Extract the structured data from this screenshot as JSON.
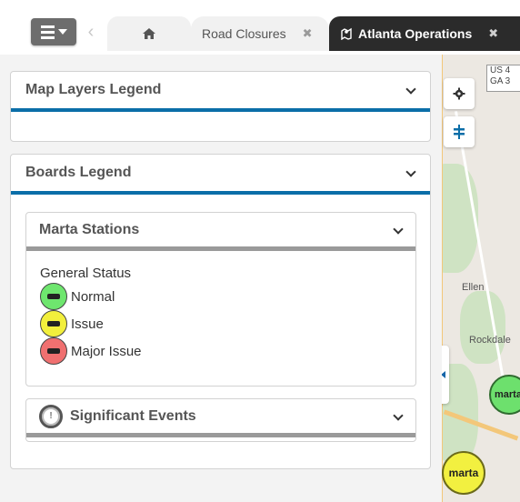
{
  "tabs": {
    "road_closures": "Road Closures",
    "atlanta_operations": "Atlanta Operations"
  },
  "panel": {
    "map_layers_title": "Map Layers Legend",
    "boards_title": "Boards Legend",
    "marta": {
      "title": "Marta Stations",
      "status_heading": "General Status",
      "statuses": [
        {
          "label": "Normal",
          "color": "#6ee66e"
        },
        {
          "label": "Issue",
          "color": "#f2ef3c"
        },
        {
          "label": "Major Issue",
          "color": "#f07070"
        }
      ]
    },
    "events": {
      "title": "Significant Events"
    }
  },
  "map": {
    "shield_text": "US 4\nGA 3",
    "labels": [
      "Ellen",
      "Rockdale"
    ],
    "marta_marker_text": "marta"
  },
  "colors": {
    "accent": "#0b6ea8",
    "dark_tab": "#2b2b2b"
  }
}
